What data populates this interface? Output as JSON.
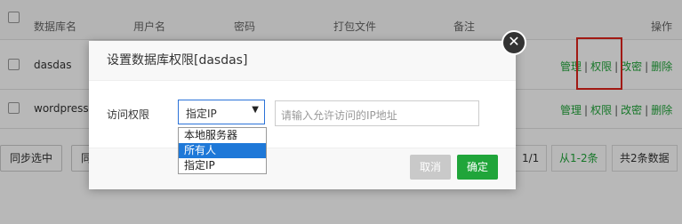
{
  "table": {
    "headers": [
      "数据库名",
      "用户名",
      "密码",
      "打包文件",
      "备注",
      "操作"
    ],
    "rows": [
      {
        "name": "dasdas"
      },
      {
        "name": "wordpress"
      }
    ],
    "actions": [
      "管理",
      "权限",
      "改密",
      "删除"
    ]
  },
  "footer": {
    "sync_selected": "同步选中",
    "second_button_partial": "同",
    "page_info": "1/1",
    "range": "从1-2条",
    "total": "共2条数据"
  },
  "modal": {
    "title": "设置数据库权限[dasdas]",
    "close_glyph": "✕",
    "access_label": "访问权限",
    "select_value": "指定IP",
    "select_arrow": "▼",
    "ip_placeholder": "请输入允许访问的IP地址",
    "options": [
      "本地服务器",
      "所有人",
      "指定IP"
    ],
    "highlighted_option_index": 1,
    "cancel": "取消",
    "confirm": "确定"
  },
  "colors": {
    "accent_green": "#20a53a",
    "highlight_red": "#e0231b",
    "option_highlight": "#1e78d8"
  }
}
